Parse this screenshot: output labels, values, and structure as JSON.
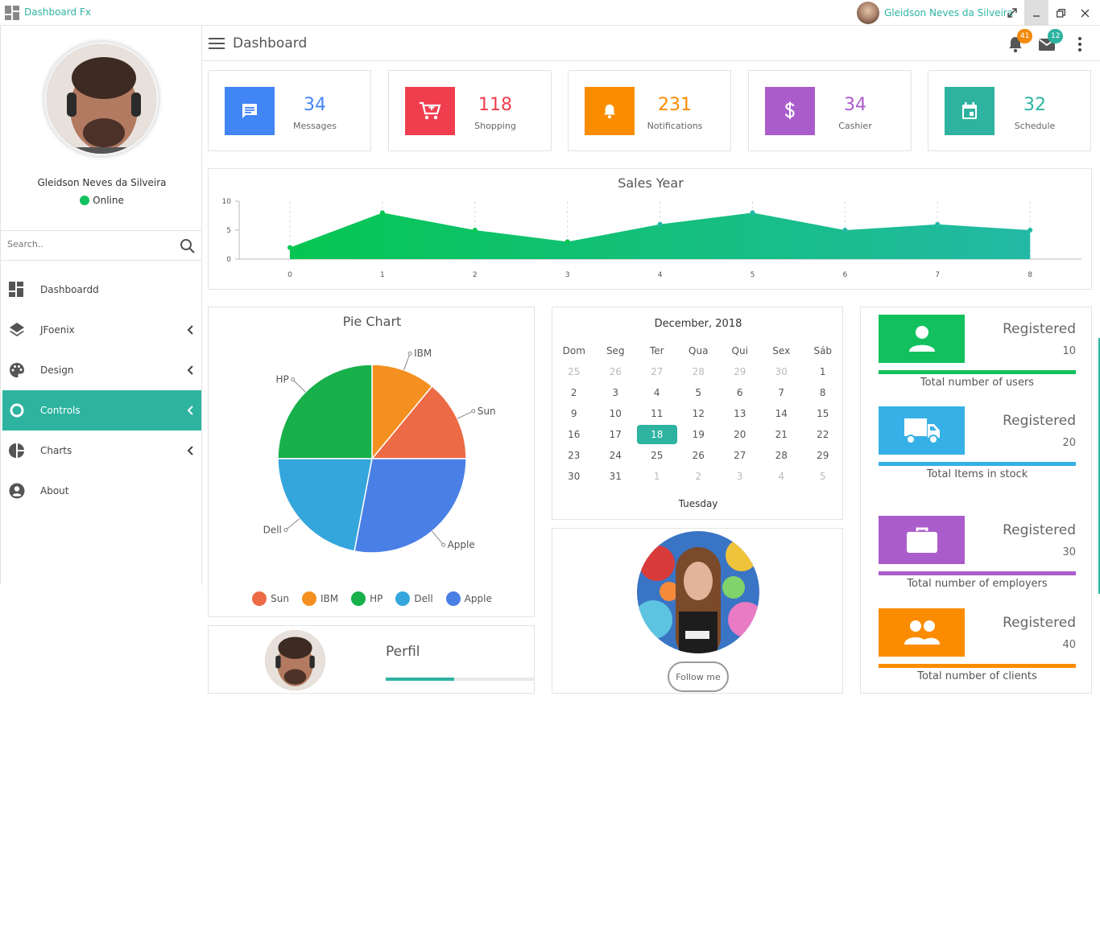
{
  "window": {
    "title": "Dashboard Fx",
    "user": "Gleidson Neves da Silveira"
  },
  "sidebar": {
    "profile_name": "Gleidson Neves da Silveira",
    "status": "Online",
    "search_placeholder": "Search..",
    "items": [
      {
        "label": "Dashboardd",
        "icon": "dashboard-icon"
      },
      {
        "label": "JFoenix",
        "icon": "layers-icon"
      },
      {
        "label": "Design",
        "icon": "palette-icon"
      },
      {
        "label": "Controls",
        "icon": "radio-circle-icon",
        "active": true
      },
      {
        "label": "Charts",
        "icon": "pie-chart-icon"
      },
      {
        "label": "About",
        "icon": "account-circle-icon"
      }
    ]
  },
  "header": {
    "title": "Dashboard",
    "notifications_count": "41",
    "messages_count": "12"
  },
  "stats": [
    {
      "value": "34",
      "label": "Messages",
      "color": "#4285f4",
      "icon": "message-icon"
    },
    {
      "value": "118",
      "label": "Shopping",
      "color": "#f03e4f",
      "icon": "cart-icon"
    },
    {
      "value": "231",
      "label": "Notifications",
      "color": "#fb8c00",
      "icon": "bell-icon"
    },
    {
      "value": "34",
      "label": "Cashier",
      "color": "#ab5ccb",
      "icon": "dollar-icon"
    },
    {
      "value": "32",
      "label": "Schedule",
      "color": "#2db3a0",
      "icon": "calendar-icon"
    }
  ],
  "sales": {
    "title": "Sales Year",
    "chart_data": {
      "type": "area",
      "x": [
        0,
        1,
        2,
        3,
        4,
        5,
        6,
        7,
        8
      ],
      "values": [
        2,
        8,
        5,
        3,
        6,
        8,
        5,
        6,
        5
      ],
      "yticks": [
        0,
        5,
        10
      ],
      "ylim": [
        0,
        10
      ],
      "grid": true
    }
  },
  "pie": {
    "title": "Pie Chart",
    "chart_data": {
      "type": "pie",
      "labels": [
        "Sun",
        "IBM",
        "HP",
        "Dell",
        "Apple"
      ],
      "values": [
        14,
        11,
        25,
        22,
        28
      ],
      "colors": [
        "#ec6a45",
        "#f3901f",
        "#17b04a",
        "#34a6dc",
        "#4a7fe6"
      ]
    }
  },
  "perfil": {
    "title": "Perfil",
    "progress": 0.46
  },
  "calendar": {
    "month": "December, 2018",
    "weekdays": [
      "Dom",
      "Seg",
      "Ter",
      "Qua",
      "Qui",
      "Sex",
      "Sáb"
    ],
    "weeks": [
      [
        "25",
        "26",
        "27",
        "28",
        "29",
        "30",
        "1"
      ],
      [
        "2",
        "3",
        "4",
        "5",
        "6",
        "7",
        "8"
      ],
      [
        "9",
        "10",
        "11",
        "12",
        "13",
        "14",
        "15"
      ],
      [
        "16",
        "17",
        "18",
        "19",
        "20",
        "21",
        "22"
      ],
      [
        "23",
        "24",
        "25",
        "26",
        "27",
        "28",
        "29"
      ],
      [
        "30",
        "31",
        "1",
        "2",
        "3",
        "4",
        "5"
      ]
    ],
    "selected": "18",
    "day_name": "Tuesday"
  },
  "follow": {
    "button": "Follow me"
  },
  "registered": [
    {
      "title": "Registered",
      "value": "10",
      "label": "Total number of users",
      "color": "#12c15e",
      "icon": "person-icon"
    },
    {
      "title": "Registered",
      "value": "20",
      "label": "Total Items in stock",
      "color": "#36b0e6",
      "icon": "truck-icon"
    },
    {
      "title": "Registered",
      "value": "30",
      "label": "Total number of employers",
      "color": "#ab5ccb",
      "icon": "briefcase-icon"
    },
    {
      "title": "Registered",
      "value": "40",
      "label": "Total number of clients",
      "color": "#fb8c00",
      "icon": "group-icon"
    }
  ]
}
